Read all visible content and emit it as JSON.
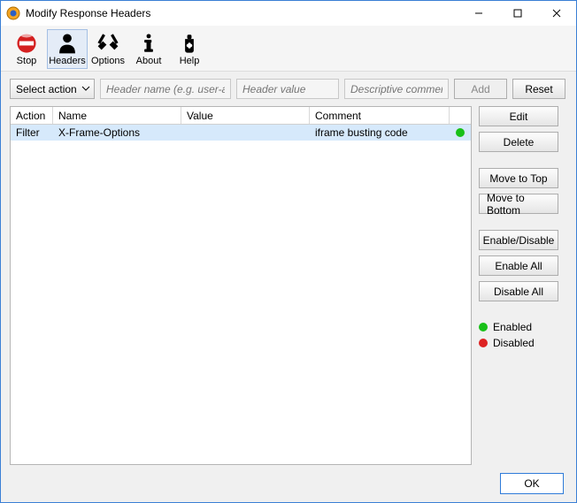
{
  "window": {
    "title": "Modify Response Headers",
    "minimize": "–",
    "maximize": "☐",
    "close": "✕"
  },
  "toolbar": {
    "items": [
      {
        "label": "Stop",
        "icon": "stop-icon"
      },
      {
        "label": "Headers",
        "icon": "headers-icon"
      },
      {
        "label": "Options",
        "icon": "options-icon"
      },
      {
        "label": "About",
        "icon": "about-icon"
      },
      {
        "label": "Help",
        "icon": "help-icon"
      }
    ],
    "active_index": 1
  },
  "controls": {
    "select_label": "Select action",
    "header_name_placeholder": "Header name (e.g. user-agent)",
    "header_value_placeholder": "Header value",
    "comment_placeholder": "Descriptive comment",
    "add_label": "Add",
    "reset_label": "Reset"
  },
  "table": {
    "columns": {
      "action": "Action",
      "name": "Name",
      "value": "Value",
      "comment": "Comment"
    },
    "rows": [
      {
        "action": "Filter",
        "name": "X-Frame-Options",
        "value": "",
        "comment": "iframe busting code",
        "enabled": true,
        "selected": true
      }
    ]
  },
  "side": {
    "edit": "Edit",
    "delete": "Delete",
    "move_top": "Move to Top",
    "move_bottom": "Move to Bottom",
    "enable_disable": "Enable/Disable",
    "enable_all": "Enable All",
    "disable_all": "Disable All",
    "legend_enabled": "Enabled",
    "legend_disabled": "Disabled"
  },
  "footer": {
    "ok": "OK"
  }
}
